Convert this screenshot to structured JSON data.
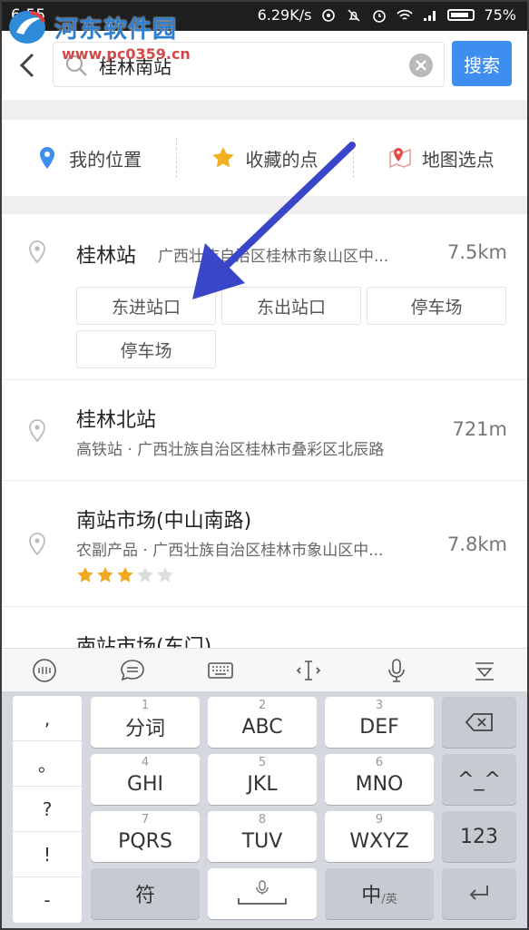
{
  "status_bar": {
    "time": "6:55",
    "speed": "6.29K/s",
    "battery": "75%"
  },
  "watermark": {
    "title": "河东软件园",
    "url": "www.pc0359.cn"
  },
  "search": {
    "query": "桂林南站",
    "button": "搜索"
  },
  "quick_actions": [
    {
      "label": "我的位置",
      "icon": "location-pin-icon",
      "color": "#3e8ef0"
    },
    {
      "label": "收藏的点",
      "icon": "star-icon",
      "color": "#f2b01e"
    },
    {
      "label": "地图选点",
      "icon": "map-pin-icon",
      "color": "#e84a4a"
    }
  ],
  "results": [
    {
      "title": "桂林站",
      "desc": "广西壮族自治区桂林市象山区中...",
      "distance": "7.5km",
      "chips": [
        "东进站口",
        "东出站口",
        "停车场",
        "停车场"
      ]
    },
    {
      "title": "桂林北站",
      "desc": "高铁站 · 广西壮族自治区桂林市叠彩区北辰路",
      "distance": "721m"
    },
    {
      "title": "南站市场(中山南路)",
      "desc": "农副产品 · 广西壮族自治区桂林市象山区中...",
      "distance": "7.8km",
      "rating": 3,
      "rating_max": 5
    },
    {
      "title": "南站市场(东门)"
    }
  ],
  "keyboard": {
    "side": [
      ",",
      "。",
      "?",
      "!",
      "-"
    ],
    "rows": [
      [
        {
          "num": "1",
          "label": "分词"
        },
        {
          "num": "2",
          "label": "ABC"
        },
        {
          "num": "3",
          "label": "DEF"
        }
      ],
      [
        {
          "num": "4",
          "label": "GHI"
        },
        {
          "num": "5",
          "label": "JKL"
        },
        {
          "num": "6",
          "label": "MNO"
        }
      ],
      [
        {
          "num": "7",
          "label": "PQRS"
        },
        {
          "num": "8",
          "label": "TUV"
        },
        {
          "num": "9",
          "label": "WXYZ"
        }
      ]
    ],
    "emoticon": "^_^",
    "num_key": "123",
    "symbol_key": "符",
    "lang_key": "中",
    "lang_sub": "/英"
  },
  "colors": {
    "accent": "#3e8ef0",
    "arrow": "#3a46c8",
    "star_on": "#f2a81d",
    "star_off": "#dddddd"
  }
}
